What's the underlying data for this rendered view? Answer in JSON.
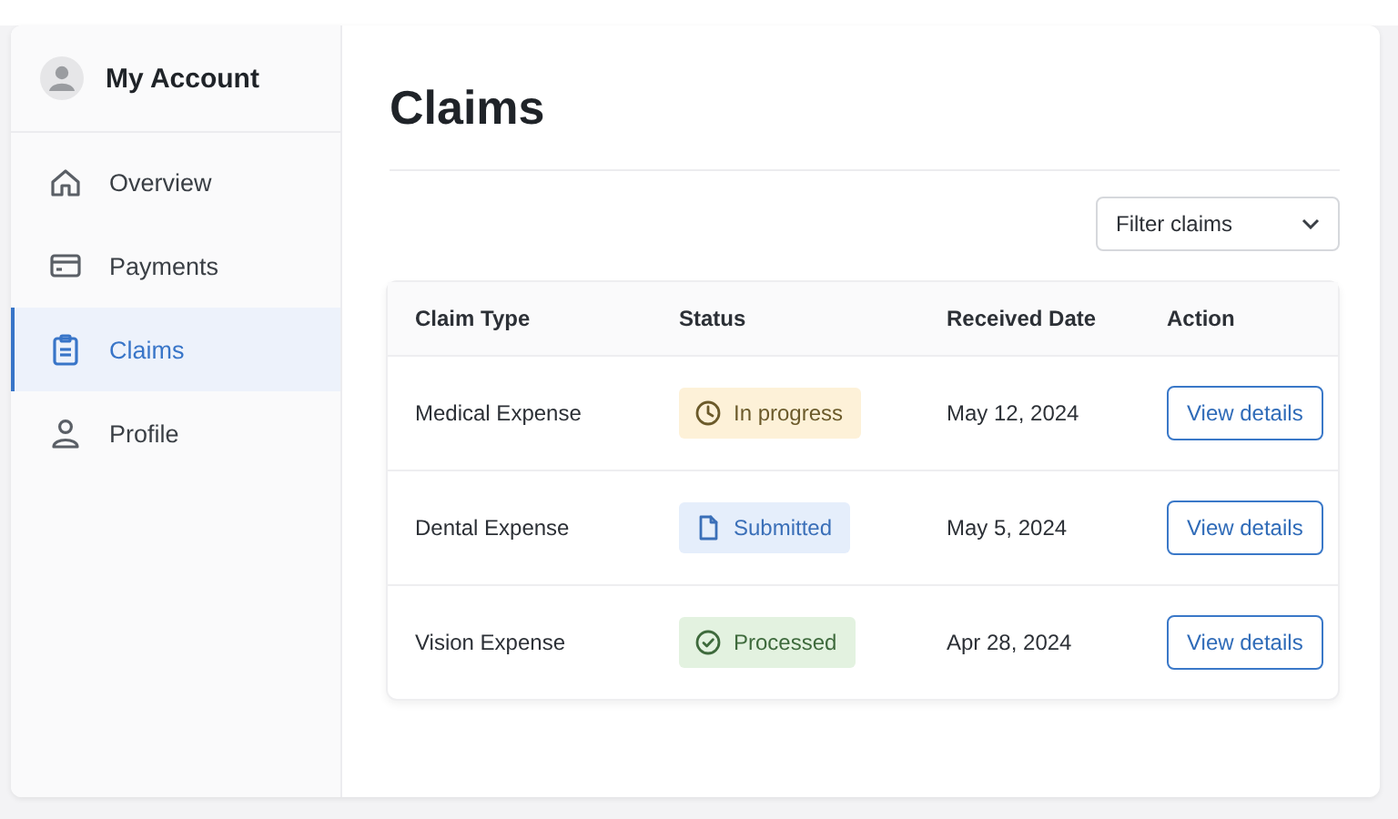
{
  "sidebar": {
    "title": "My Account",
    "items": [
      {
        "label": "Overview",
        "selected": false
      },
      {
        "label": "Payments",
        "selected": false
      },
      {
        "label": "Claims",
        "selected": true
      },
      {
        "label": "Profile",
        "selected": false
      }
    ]
  },
  "page_title": "Claims",
  "filter": {
    "label": "Filter claims"
  },
  "table": {
    "columns": [
      "Claim Type",
      "Status",
      "Received Date",
      "Action"
    ],
    "rows": [
      {
        "claim_type": "Medical Expense",
        "status": {
          "label": "In progress",
          "kind": "progress"
        },
        "received_date": "May 12, 2024",
        "action": "View details"
      },
      {
        "claim_type": "Dental Expense",
        "status": {
          "label": "Submitted",
          "kind": "submitted"
        },
        "received_date": "May 5, 2024",
        "action": "View details"
      },
      {
        "claim_type": "Vision Expense",
        "status": {
          "label": "Processed",
          "kind": "processed"
        },
        "received_date": "Apr 28, 2024",
        "action": "View details"
      }
    ]
  }
}
